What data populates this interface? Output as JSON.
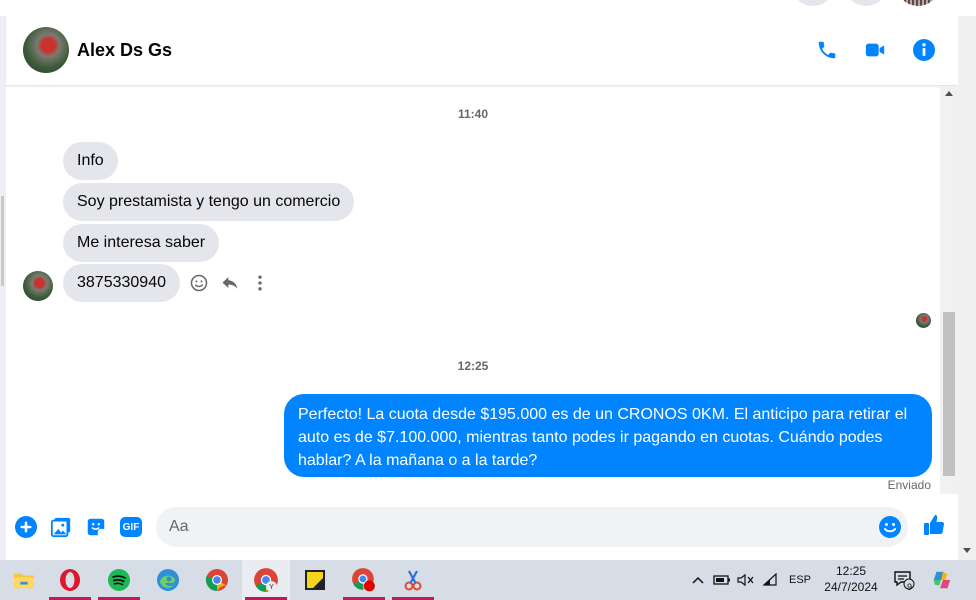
{
  "contact": {
    "name": "Alex Ds Gs"
  },
  "header_actions": {
    "call_icon": "phone-icon",
    "video_icon": "video-camera-icon",
    "info_icon": "info-icon"
  },
  "messages": {
    "timestamp_1": "11:40",
    "incoming": [
      "Info",
      "Soy prestamista y tengo un comercio",
      "Me interesa saber",
      "3875330940"
    ],
    "timestamp_2": "12:25",
    "outgoing": "Perfecto! La cuota desde $195.000 es de un CRONOS 0KM. El anticipo para retirar el auto es de $7.100.000, mientras tanto podes ir pagando en cuotas. Cuándo podes hablar? A la mañana o a la tarde?",
    "status": "Enviado"
  },
  "composer": {
    "placeholder": "Aa",
    "value": "",
    "gif_label": "GIF"
  },
  "taskbar": {
    "apps": [
      "file-explorer",
      "opera",
      "spotify",
      "edge",
      "chrome",
      "chrome-profile",
      "sticky-notes",
      "chrome-recording",
      "snipping-tool"
    ],
    "language": "ESP",
    "time": "12:25",
    "date": "24/7/2024",
    "notification_count": "9"
  },
  "colors": {
    "accent": "#0084ff",
    "incoming_bubble": "#e4e6eb",
    "taskbar": "#d6dde6"
  }
}
